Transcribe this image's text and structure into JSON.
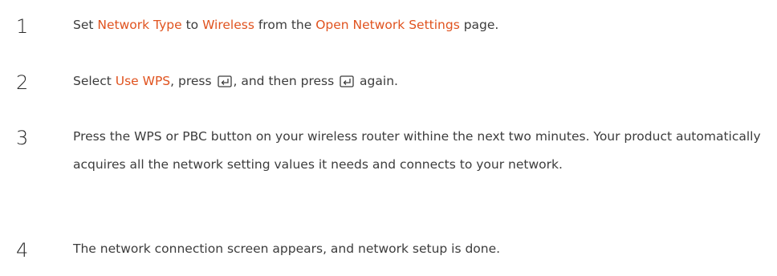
{
  "steps": [
    {
      "number": "1",
      "parts": {
        "a": "Set ",
        "b": "Network Type",
        "c": " to ",
        "d": "Wireless",
        "e": " from the ",
        "f": "Open Network Settings",
        "g": " page."
      }
    },
    {
      "number": "2",
      "parts": {
        "a": "Select ",
        "b": "Use WPS",
        "c": ", press ",
        "d": ", and then press ",
        "e": " again."
      }
    },
    {
      "number": "3",
      "text": "Press the WPS or PBC button on your wireless router withine the next two minutes. Your product automatically acquires all the network setting values it needs and connects to your network."
    },
    {
      "number": "4",
      "text": "The network connection screen appears, and network setup is done."
    }
  ],
  "colors": {
    "highlight": "#e0531f",
    "text": "#3c3c3c"
  },
  "icons": {
    "enter": "enter-key-icon"
  }
}
